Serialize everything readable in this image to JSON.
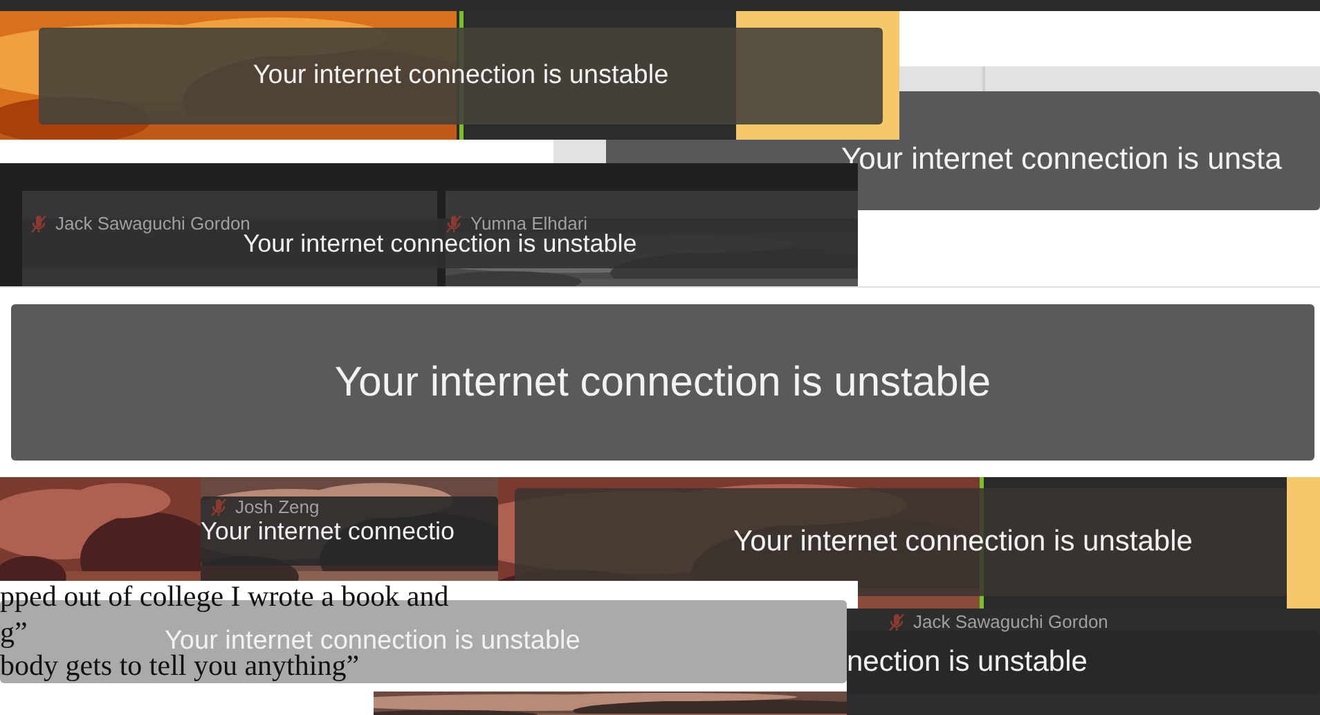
{
  "collage": [
    {
      "kind": "call",
      "banner": "Your internet connection is unstable"
    },
    {
      "kind": "call",
      "banner": "Your internet connection is unsta"
    },
    {
      "kind": "call",
      "names": [
        "Jack Sawaguchi Gordon",
        "Yumna Elhdari"
      ],
      "banner": "Your internet connection is unstable"
    },
    {
      "kind": "big",
      "banner": "Your internet connection is unstable"
    },
    {
      "kind": "call",
      "names": [
        "Josh Zeng"
      ],
      "banner": "Your internet connectio"
    },
    {
      "kind": "call",
      "banner": "Your internet connection is unstable"
    },
    {
      "kind": "article",
      "lines": [
        "pped out of college I wrote a book and",
        "g”",
        "body gets to tell you anything”"
      ],
      "banner": "Your internet connection is unstable"
    },
    {
      "kind": "call",
      "names": [
        "Jack Sawaguchi Gordon"
      ],
      "banner": "nection is unstable"
    }
  ]
}
